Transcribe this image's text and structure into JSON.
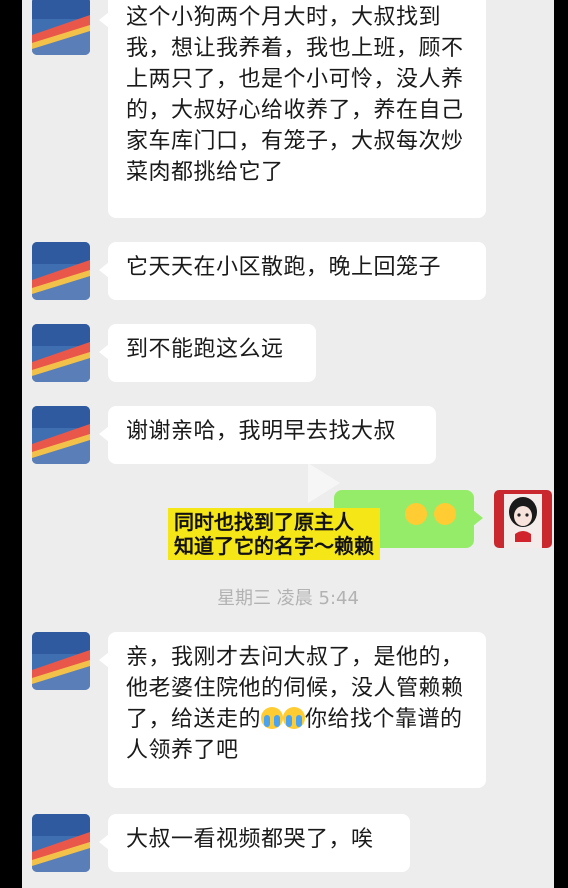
{
  "messages": [
    {
      "side": "left",
      "text": "这个小狗两个月大时，大叔找到我，想让我养着，我也上班，顾不上两只了，也是个小可怜，没人养的，大叔好心给收养了，养在自己家车库门口，有笼子，大叔每次炒菜肉都挑给它了"
    },
    {
      "side": "left",
      "text": "它天天在小区散跑，晚上回笼子"
    },
    {
      "side": "left",
      "text": "到不能跑这么远"
    },
    {
      "side": "left",
      "text": "谢谢亲哈，我明早去找大叔"
    },
    {
      "side": "left",
      "text_before": "亲，我刚才去问大叔了，是他的，他老婆住院他的伺候，没人管赖赖了，给送走的",
      "text_after": "你给找个靠谱的人领养了吧"
    },
    {
      "side": "left",
      "text": "大叔一看视频都哭了，唉"
    }
  ],
  "timestamp": "星期三 凌晨 5:44",
  "subtitle": {
    "line1": "同时也找到了原主人",
    "line2": "知道了它的名字～赖赖"
  },
  "emoji_names": [
    "smile-emoji",
    "crying-emoji"
  ],
  "colors": {
    "background": "#ededed",
    "bubble_left": "#ffffff",
    "bubble_right": "#95ec69",
    "subtitle_bg": "#f5e617"
  }
}
